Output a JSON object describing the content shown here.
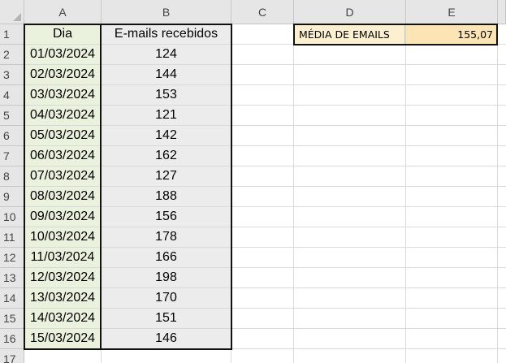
{
  "columns": [
    "A",
    "B",
    "C",
    "D",
    "E"
  ],
  "rows": [
    "1",
    "2",
    "3",
    "4",
    "5",
    "6",
    "7",
    "8",
    "9",
    "10",
    "11",
    "12",
    "13",
    "14",
    "15",
    "16",
    "17"
  ],
  "table": {
    "header_dia": "Dia",
    "header_emails": "E-mails recebidos",
    "records": [
      {
        "dia": "01/03/2024",
        "emails": "124"
      },
      {
        "dia": "02/03/2024",
        "emails": "144"
      },
      {
        "dia": "03/03/2024",
        "emails": "153"
      },
      {
        "dia": "04/03/2024",
        "emails": "121"
      },
      {
        "dia": "05/03/2024",
        "emails": "142"
      },
      {
        "dia": "06/03/2024",
        "emails": "162"
      },
      {
        "dia": "07/03/2024",
        "emails": "127"
      },
      {
        "dia": "08/03/2024",
        "emails": "188"
      },
      {
        "dia": "09/03/2024",
        "emails": "156"
      },
      {
        "dia": "10/03/2024",
        "emails": "178"
      },
      {
        "dia": "11/03/2024",
        "emails": "166"
      },
      {
        "dia": "12/03/2024",
        "emails": "198"
      },
      {
        "dia": "13/03/2024",
        "emails": "170"
      },
      {
        "dia": "14/03/2024",
        "emails": "151"
      },
      {
        "dia": "15/03/2024",
        "emails": "146"
      }
    ]
  },
  "summary": {
    "label": "MÉDIA DE EMAILS",
    "value": "155,07"
  },
  "colors": {
    "header_bg": "#e6e6e6",
    "dia_fill": "#eaf1dd",
    "emails_fill": "#ececec",
    "label_fill": "#fdf0d0",
    "value_fill": "#fce4b4"
  }
}
